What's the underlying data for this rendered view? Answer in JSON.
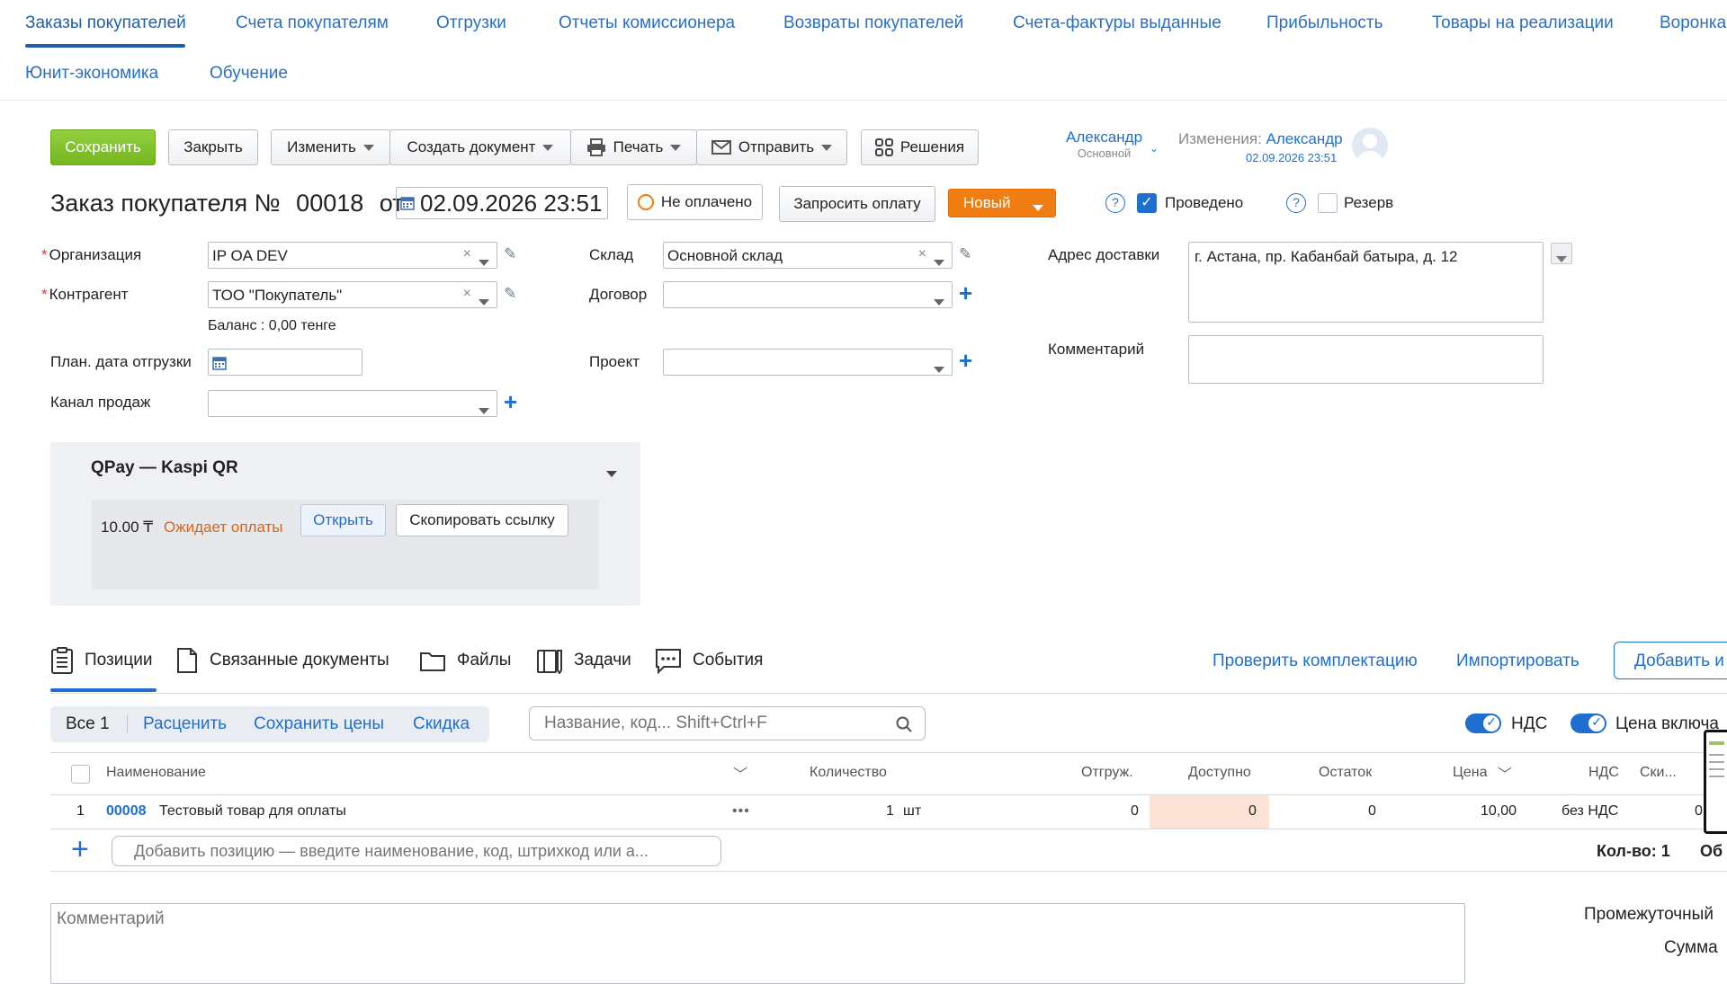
{
  "nav": {
    "row1": [
      "Заказы покупателей",
      "Счета покупателям",
      "Отгрузки",
      "Отчеты комиссионера",
      "Возвраты покупателей",
      "Счета-фактуры выданные",
      "Прибыльность",
      "Товары на реализации",
      "Воронка"
    ],
    "row2": [
      "Юнит-экономика",
      "Обучение"
    ]
  },
  "toolbar": {
    "save": "Сохранить",
    "close": "Закрыть",
    "change": "Изменить",
    "create_doc": "Создать документ",
    "print": "Печать",
    "send": "Отправить",
    "solutions": "Решения"
  },
  "user": {
    "name": "Александр",
    "role": "Основной",
    "changes_label": "Изменения:",
    "changes_user": "Александр",
    "changes_date": "02.09.2026 23:51"
  },
  "doc": {
    "title_prefix": "Заказ покупателя №",
    "number": "00018",
    "from": "от",
    "date": "02.09.2026 23:51",
    "payment_status": "Не оплачено",
    "request_payment": "Запросить оплату",
    "state": "Новый",
    "posted_label": "Проведено",
    "posted": true,
    "reserve_label": "Резерв",
    "reserve": false
  },
  "form": {
    "organization_label": "Организация",
    "organization": "IP OA DEV",
    "counterparty_label": "Контрагент",
    "counterparty": "ТОО \"Покупатель\"",
    "balance": "Баланс : 0,00 тенге",
    "ship_date_label": "План. дата отгрузки",
    "sales_channel_label": "Канал продаж",
    "warehouse_label": "Склад",
    "warehouse": "Основной склад",
    "contract_label": "Договор",
    "project_label": "Проект",
    "address_label": "Адрес доставки",
    "address": "г. Астана, пр. Кабанбай батыра, д. 12",
    "comment_label": "Комментарий"
  },
  "qpay": {
    "title": "QPay — Kaspi QR",
    "amount": "10.00 ₸",
    "status": "Ожидает оплаты",
    "open": "Открыть",
    "copy_link": "Скопировать ссылку"
  },
  "tabs": [
    "Позиции",
    "Связанные документы",
    "Файлы",
    "Задачи",
    "События"
  ],
  "actions": {
    "check": "Проверить комплектацию",
    "import": "Импортировать",
    "add": "Добавить и"
  },
  "filter": {
    "all": "Все 1",
    "reprice": "Расценить",
    "save_prices": "Сохранить цены",
    "discount": "Скидка",
    "search_placeholder": "Название, код... Shift+Ctrl+F",
    "vat": "НДС",
    "price_incl": "Цена включа"
  },
  "table": {
    "headers": {
      "name": "Наименование",
      "qty": "Количество",
      "shipped": "Отгруж.",
      "available": "Доступно",
      "remaining": "Остаток",
      "price": "Цена",
      "vat": "НДС",
      "discount": "Ски..."
    },
    "rows": [
      {
        "n": "1",
        "code": "00008",
        "name": "Тестовый товар для оплаты",
        "qty": "1",
        "unit": "шт",
        "shipped": "0",
        "available": "0",
        "remaining": "0",
        "price": "10,00",
        "vat": "без НДС",
        "discount": "0"
      }
    ],
    "add_placeholder": "Добавить позицию — введите наименование, код, штрихкод или а...",
    "count": "Кол-во: 1",
    "total_cut": "Об"
  },
  "footer": {
    "comment_placeholder": "Комментарий",
    "subtotal": "Промежуточный",
    "sum": "Сумма"
  },
  "colors": {
    "accent": "#1f6fd1",
    "save_green": "#7dbe2a",
    "state_orange": "#f07d12",
    "available_bg": "#fde3d6",
    "pending_orange": "#d4661e"
  }
}
